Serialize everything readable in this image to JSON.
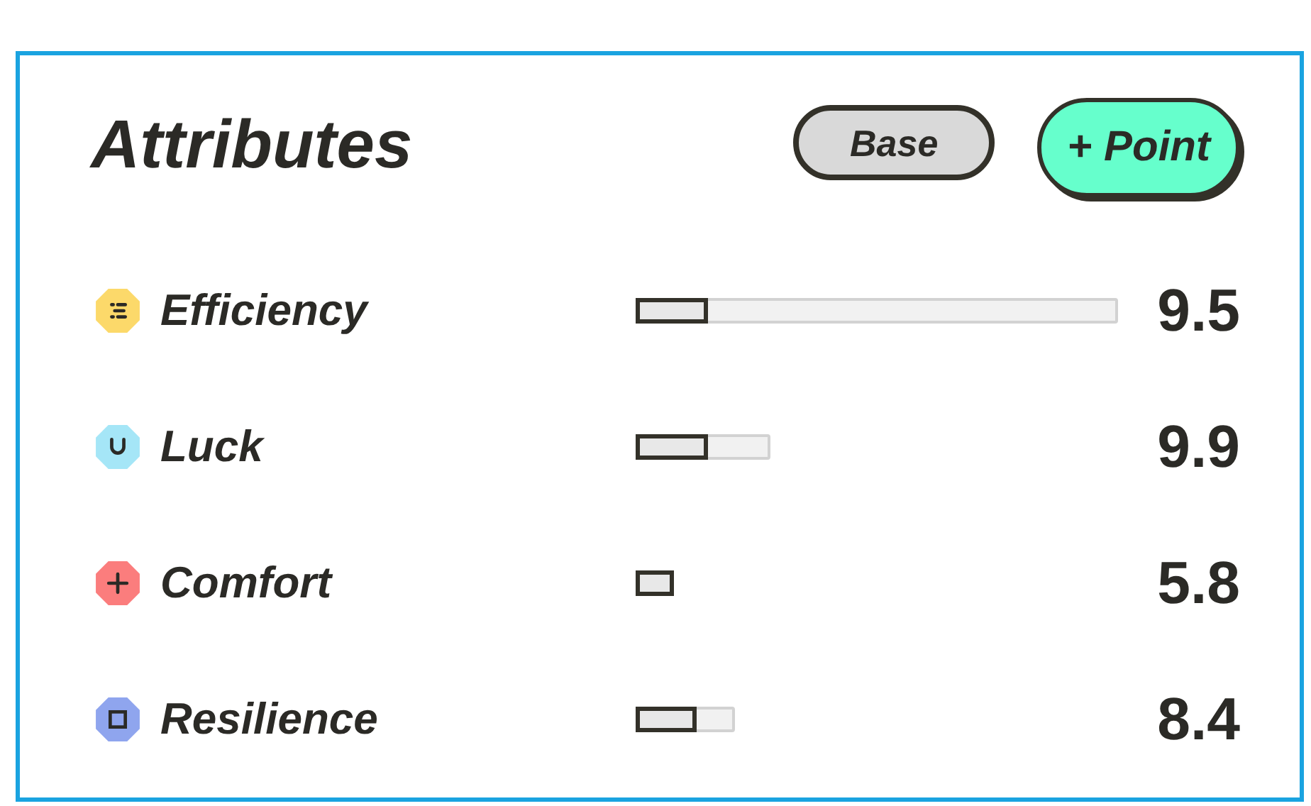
{
  "title": "Attributes",
  "buttons": [
    {
      "label": "Base",
      "kind": "secondary"
    },
    {
      "label": "+ Point",
      "kind": "primary"
    }
  ],
  "attributes": [
    {
      "name": "Efficiency",
      "color": "#fcd96a",
      "bar": {
        "level": 0.15
      },
      "value": "9.5"
    },
    {
      "name": "Luck",
      "color": "#a5e6f7",
      "value": "9.9"
    },
    {
      "name": "Comfort",
      "color": "#fb7d7d",
      "value": "5.8"
    },
    {
      "name": "Resilience",
      "color": "#8fa5ee",
      "value": "8.4"
    }
  ]
}
